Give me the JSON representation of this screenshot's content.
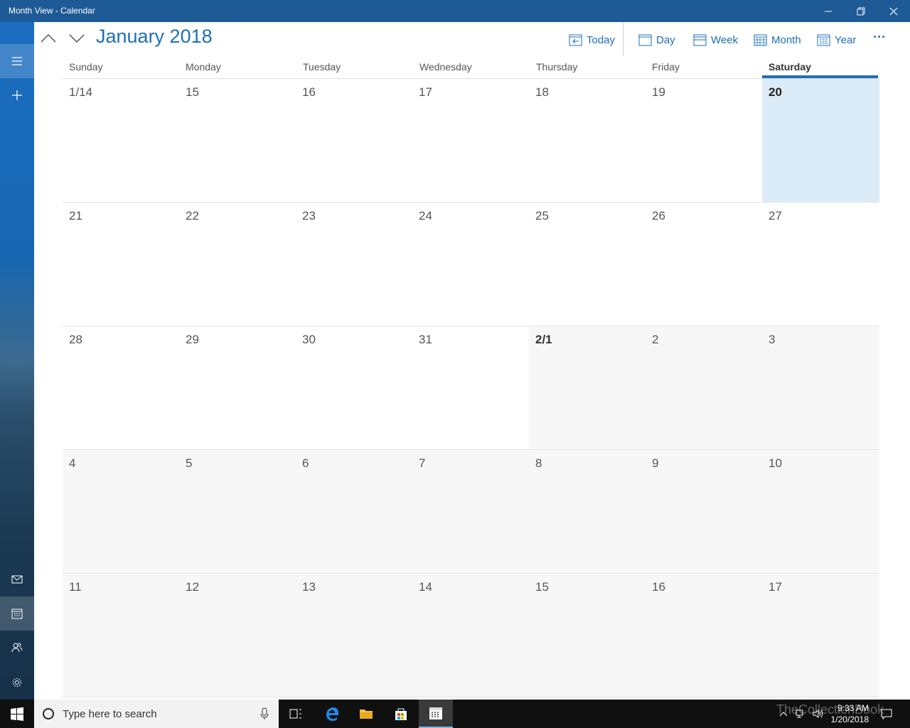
{
  "window": {
    "title": "Month View - Calendar",
    "controls": {
      "minimize": "minimize",
      "restore": "restore",
      "close": "close"
    }
  },
  "header": {
    "month_title": "January 2018",
    "toolbar": {
      "today": "Today",
      "day": "Day",
      "week": "Week",
      "month": "Month",
      "year": "Year",
      "more": "···"
    }
  },
  "weekdays": [
    "Sunday",
    "Monday",
    "Tuesday",
    "Wednesday",
    "Thursday",
    "Friday",
    "Saturday"
  ],
  "weeks": [
    [
      "1/14",
      "15",
      "16",
      "17",
      "18",
      "19",
      "20"
    ],
    [
      "21",
      "22",
      "23",
      "24",
      "25",
      "26",
      "27"
    ],
    [
      "28",
      "29",
      "30",
      "31",
      "2/1",
      "2",
      "3"
    ],
    [
      "4",
      "5",
      "6",
      "7",
      "8",
      "9",
      "10"
    ],
    [
      "11",
      "12",
      "13",
      "14",
      "15",
      "16",
      "17"
    ]
  ],
  "today_label": "20",
  "taskbar": {
    "search_placeholder": "Type here to search",
    "time": "9:33 AM",
    "date": "1/20/2018",
    "watermark": "TheCollectionBook"
  },
  "colors": {
    "accent": "#1e6fb8",
    "titlebar": "#1e5a96",
    "today_cell": "#dcebf8",
    "other_month_cell": "#f7f7f7"
  }
}
